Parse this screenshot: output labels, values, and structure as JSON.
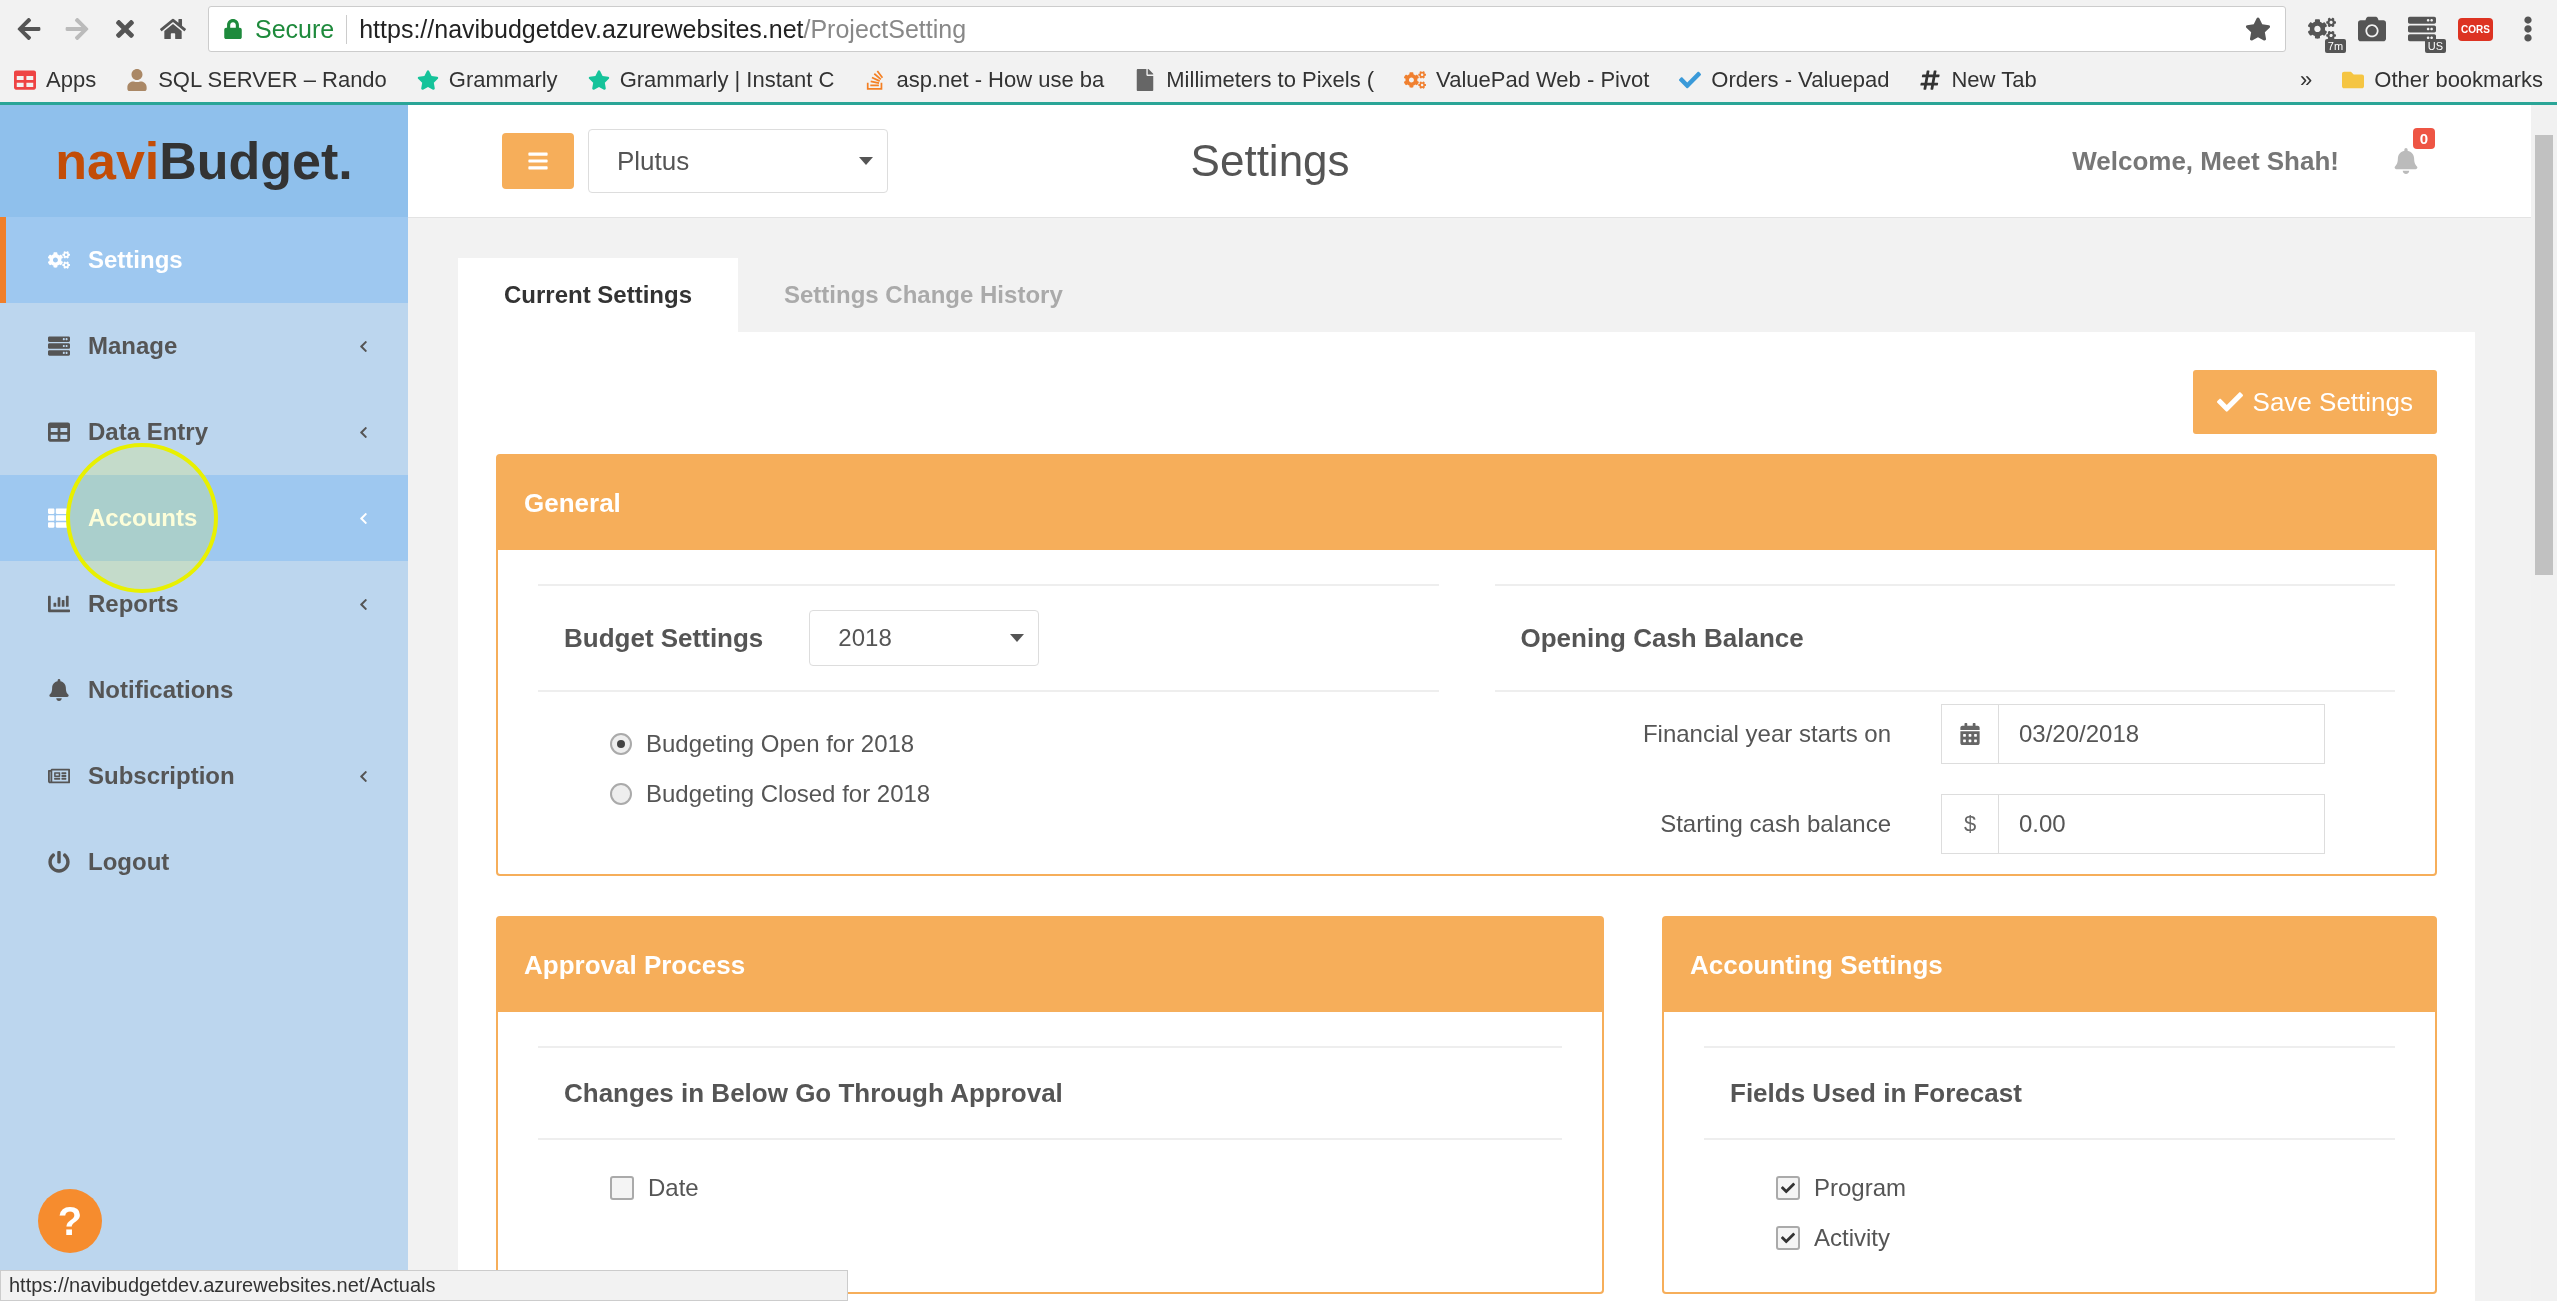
{
  "browser": {
    "url": {
      "secure": "Secure",
      "host": "https://navibudgetdev.azurewebsites.net",
      "path": "/ProjectSetting"
    },
    "extension_badges": [
      "7m",
      "US",
      "CORS"
    ],
    "bookmarks": [
      {
        "label": "Apps",
        "kind": "apps"
      },
      {
        "label": "SQL SERVER – Rando",
        "kind": "photo"
      },
      {
        "label": "Grammarly",
        "kind": "grammarly"
      },
      {
        "label": "Grammarly | Instant C",
        "kind": "grammarly"
      },
      {
        "label": "asp.net - How use ba",
        "kind": "stack"
      },
      {
        "label": "Millimeters to Pixels (",
        "kind": "page"
      },
      {
        "label": "ValuePad Web - Pivot",
        "kind": "valuepad"
      },
      {
        "label": "Orders - Valuepad",
        "kind": "check"
      },
      {
        "label": "New Tab",
        "kind": "hash"
      }
    ],
    "overflow": "»",
    "other_bookmarks": "Other bookmarks"
  },
  "sidebar": {
    "logo": {
      "part1": "navi",
      "part2": "Budget."
    },
    "items": [
      {
        "label": "Settings",
        "selected": true,
        "hovered": false,
        "expandable": false
      },
      {
        "label": "Manage",
        "selected": false,
        "hovered": false,
        "expandable": true
      },
      {
        "label": "Data Entry",
        "selected": false,
        "hovered": false,
        "expandable": true
      },
      {
        "label": "Accounts",
        "selected": false,
        "hovered": true,
        "expandable": true
      },
      {
        "label": "Reports",
        "selected": false,
        "hovered": false,
        "expandable": true
      },
      {
        "label": "Notifications",
        "selected": false,
        "hovered": false,
        "expandable": false
      },
      {
        "label": "Subscription",
        "selected": false,
        "hovered": false,
        "expandable": true
      },
      {
        "label": "Logout",
        "selected": false,
        "hovered": false,
        "expandable": false
      }
    ],
    "help": "?"
  },
  "header": {
    "project": "Plutus",
    "title": "Settings",
    "welcome": "Welcome, Meet Shah!",
    "notification_count": "0"
  },
  "tabs": [
    {
      "label": "Current Settings",
      "selected": true
    },
    {
      "label": "Settings Change History",
      "selected": false
    }
  ],
  "save_button": "Save Settings",
  "general": {
    "title": "General",
    "budget_settings": {
      "label": "Budget Settings",
      "year": "2018"
    },
    "radios": [
      {
        "label": "Budgeting Open for 2018",
        "selected": true
      },
      {
        "label": "Budgeting Closed for 2018",
        "selected": false
      }
    ],
    "opening_cash": {
      "title": "Opening Cash Balance",
      "fields": [
        {
          "label": "Financial year starts on",
          "kind": "calendar",
          "value": "03/20/2018"
        },
        {
          "label": "Starting cash balance",
          "kind": "text",
          "addon": "$",
          "value": "0.00"
        }
      ]
    }
  },
  "approval": {
    "title": "Approval Process",
    "subtitle": "Changes in Below Go Through Approval",
    "options": [
      {
        "label": "Date",
        "checked": false
      }
    ]
  },
  "accounting": {
    "title": "Accounting Settings",
    "subtitle": "Fields Used in Forecast",
    "options": [
      {
        "label": "Program",
        "checked": true
      },
      {
        "label": "Activity",
        "checked": true
      }
    ]
  },
  "status_url": "https://navibudgetdev.azurewebsites.net/Actuals"
}
